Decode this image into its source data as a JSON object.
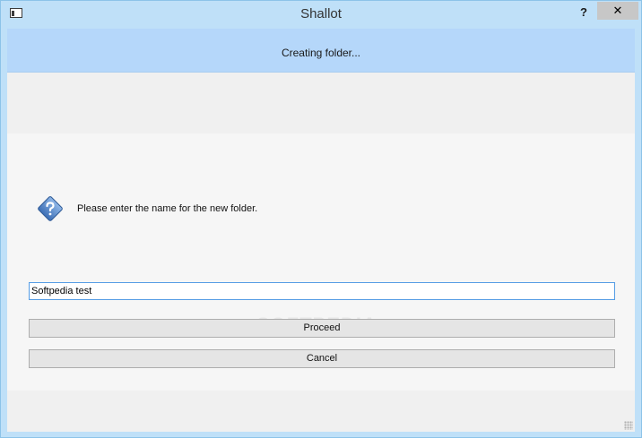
{
  "window": {
    "title": "Shallot",
    "help_glyph": "?",
    "close_glyph": "✕"
  },
  "header": {
    "title": "Creating folder..."
  },
  "dialog": {
    "icon": "question-icon",
    "prompt": "Please enter the name for the new folder.",
    "input_value": "Softpedia test"
  },
  "buttons": {
    "proceed_label": "Proceed",
    "cancel_label": "Cancel"
  },
  "watermark": {
    "text": "SOFTPEDIA"
  },
  "colors": {
    "title_bar": "#bfe0f8",
    "header_banner": "#b5d7fa",
    "input_border": "#569de5",
    "button_face": "#e5e5e5"
  }
}
